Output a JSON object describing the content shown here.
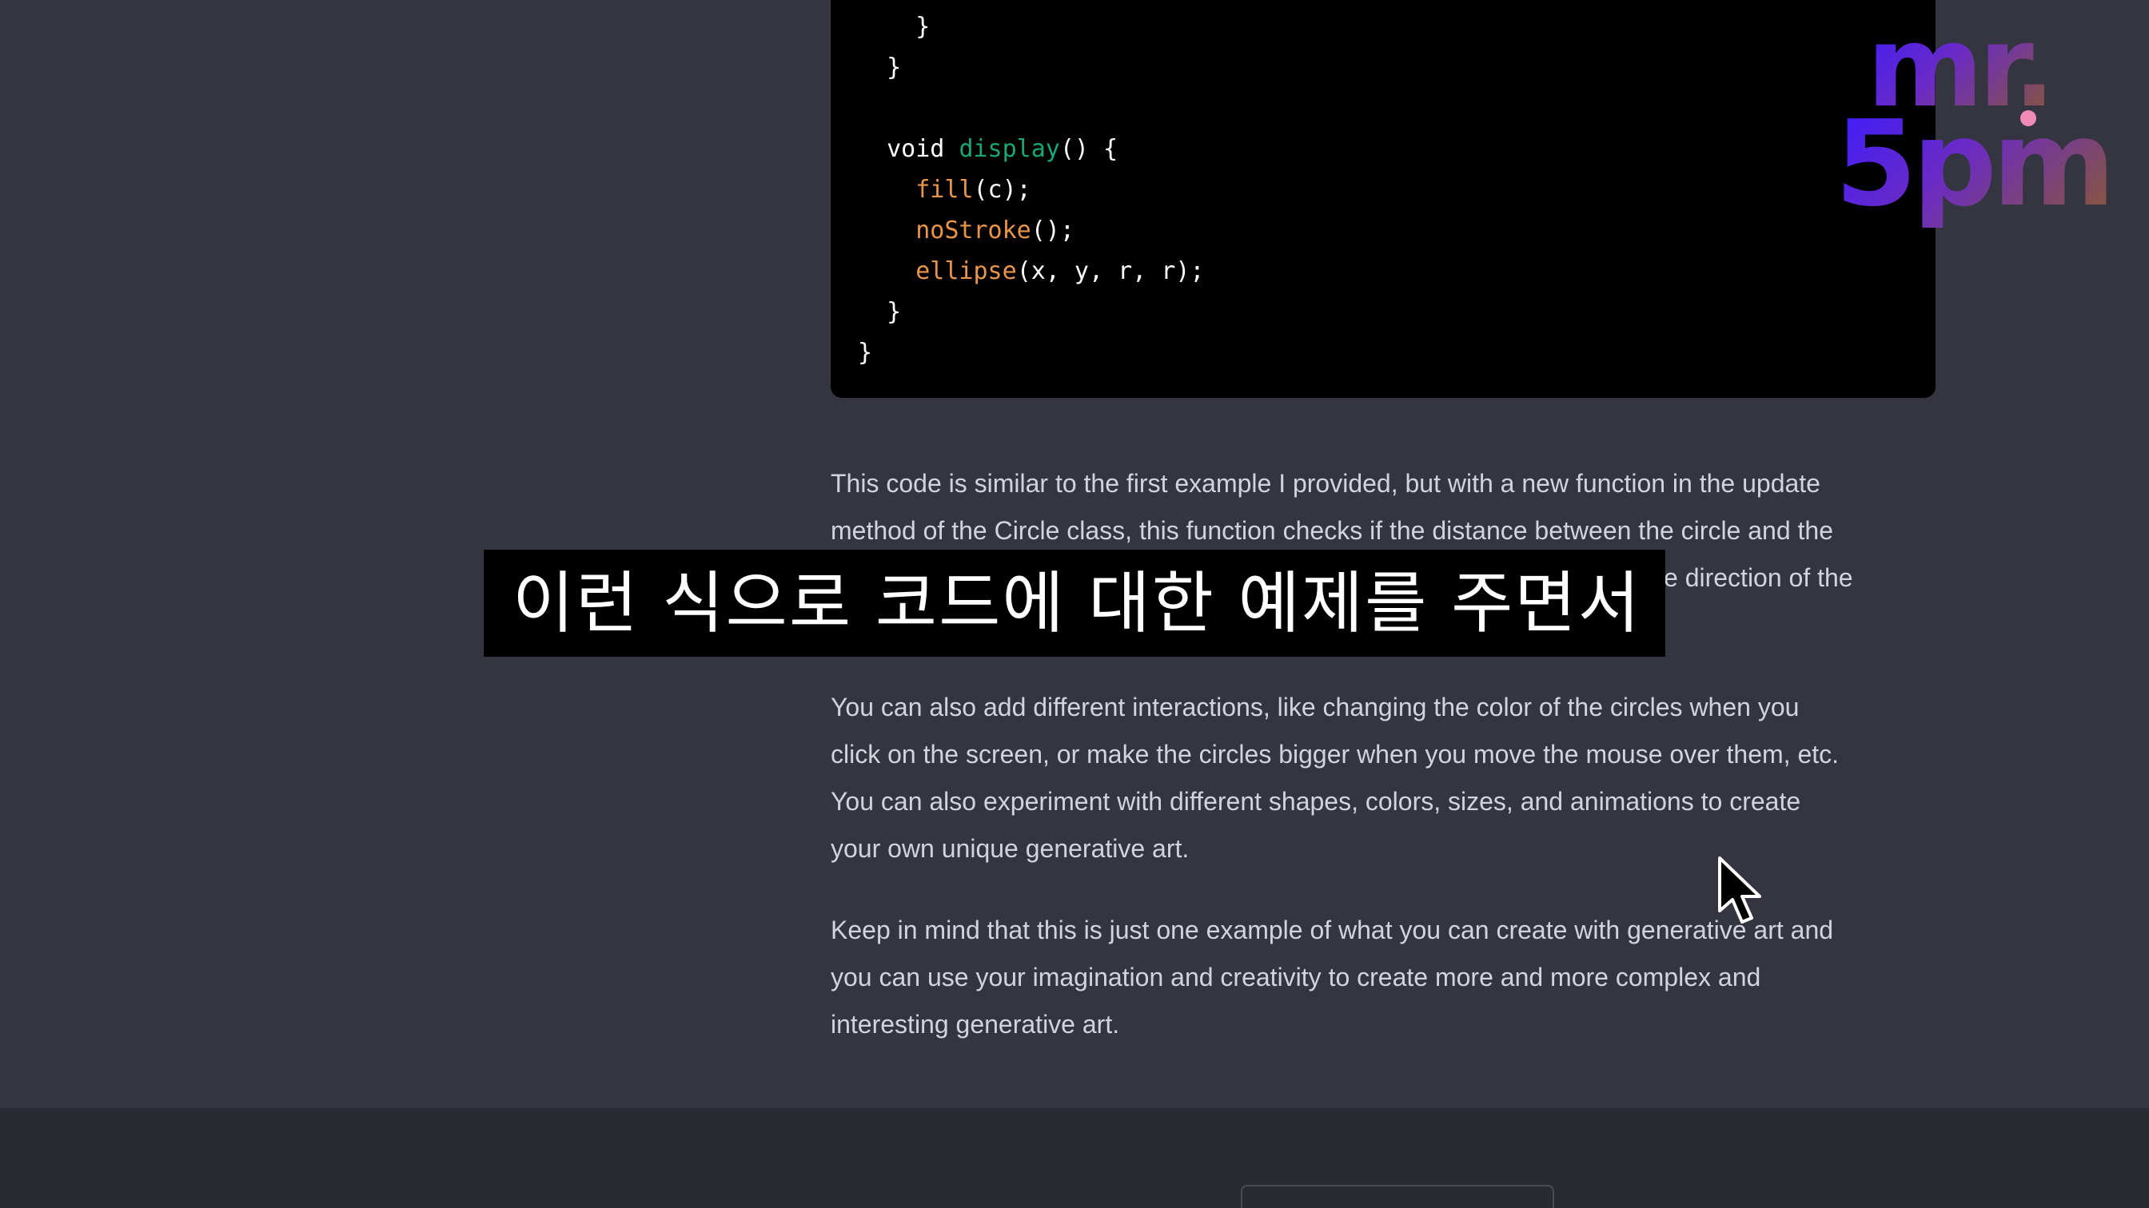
{
  "code": {
    "lines": [
      {
        "indent": "    ",
        "tokens": [
          {
            "t": "}",
            "k": "kw"
          }
        ]
      },
      {
        "indent": "  ",
        "tokens": [
          {
            "t": "}",
            "k": "kw"
          }
        ]
      },
      {
        "indent": "",
        "tokens": []
      },
      {
        "indent": "  ",
        "tokens": [
          {
            "t": "void ",
            "k": "kw"
          },
          {
            "t": "display",
            "k": "fn"
          },
          {
            "t": "() {",
            "k": "kw"
          }
        ]
      },
      {
        "indent": "    ",
        "tokens": [
          {
            "t": "fill",
            "k": "builtin"
          },
          {
            "t": "(c);",
            "k": "kw"
          }
        ]
      },
      {
        "indent": "    ",
        "tokens": [
          {
            "t": "noStroke",
            "k": "builtin"
          },
          {
            "t": "();",
            "k": "kw"
          }
        ]
      },
      {
        "indent": "    ",
        "tokens": [
          {
            "t": "ellipse",
            "k": "builtin"
          },
          {
            "t": "(x, y, r, r);",
            "k": "kw"
          }
        ]
      },
      {
        "indent": "  ",
        "tokens": [
          {
            "t": "}",
            "k": "kw"
          }
        ]
      },
      {
        "indent": "",
        "tokens": [
          {
            "t": "}",
            "k": "kw"
          }
        ]
      }
    ]
  },
  "paragraphs": {
    "p1": {
      "lines": [
        "This code is similar to the first example I provided, but with a new function in the update",
        "method of the Circle class, this function checks if the distance between the circle and the",
        "e direction of the"
      ]
    },
    "p2": {
      "lines": [
        "You can also add different interactions, like changing the color of the circles when you",
        "click on the screen, or make the circles bigger when you move the mouse over them, etc.",
        "You can also experiment with different shapes, colors, sizes, and animations to create",
        "your own unique generative art."
      ]
    },
    "p3": {
      "lines": [
        "Keep in mind that this is just one example of what you can create with generative art and",
        "you can use your imagination and creativity to create more and more complex and",
        "interesting generative art."
      ]
    }
  },
  "subtitle": {
    "text": "이런 식으로 코드에 대한 예제를 주면서"
  },
  "logo": {
    "line1": "mr.",
    "line2": "5pm"
  },
  "colors": {
    "background": "#343541",
    "code_background": "#000000",
    "code_function": "#19a67b",
    "code_builtin": "#e9954a",
    "paragraph_text": "#d1d5db",
    "footer": "#2a2b32",
    "logo_dot": "#f08bb5"
  },
  "icons": {
    "cursor": "arrow-cursor-icon"
  }
}
